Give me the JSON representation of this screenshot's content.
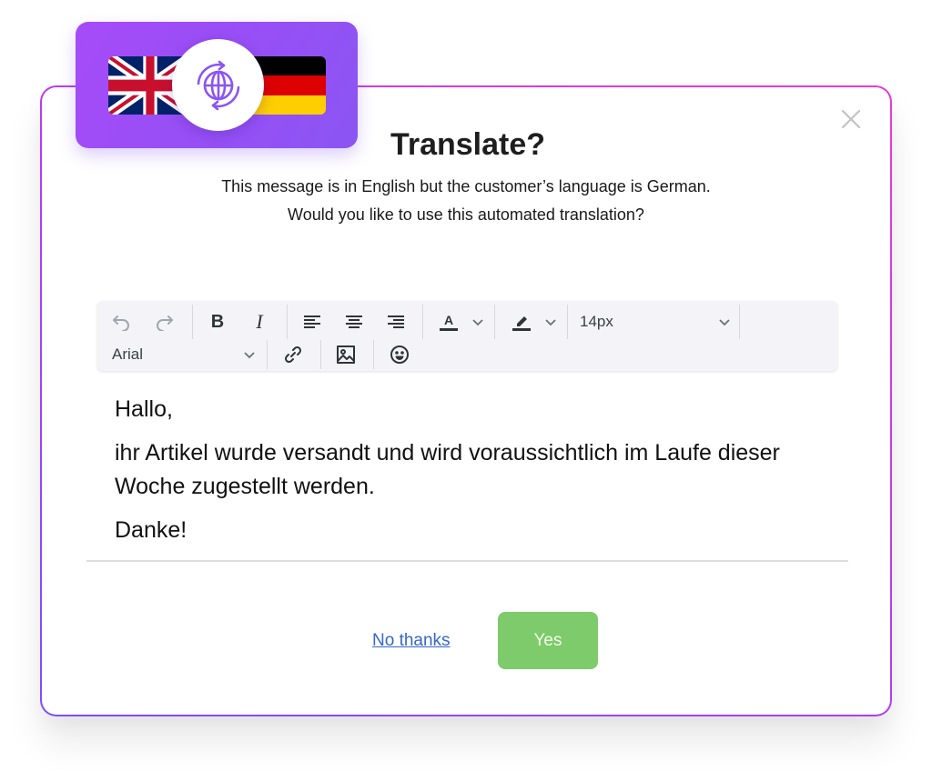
{
  "dialog": {
    "title": "Translate?",
    "message_line1": "This message is in English but the customer’s language is German.",
    "message_line2": "Would you like to use this automated translation?",
    "source_language": "English",
    "target_language": "German",
    "icons": {
      "source_flag": "uk-flag-icon",
      "target_flag": "germany-flag-icon",
      "translate": "globe-sync-icon",
      "close": "close-icon"
    }
  },
  "toolbar": {
    "undo": "undo-icon",
    "redo": "redo-icon",
    "bold": "bold-icon",
    "italic": "italic-icon",
    "align_left": "align-left-icon",
    "align_center": "align-center-icon",
    "align_right": "align-right-icon",
    "text_color": "text-color-icon",
    "highlight": "highlight-icon",
    "font_size": "14px",
    "font_family": "Arial",
    "link": "link-icon",
    "image": "image-icon",
    "emoji": "emoji-icon"
  },
  "editor": {
    "paragraphs": [
      "Hallo,",
      "ihr Artikel wurde versandt und wird voraussichtlich im Laufe dieser Woche zugestellt werden.",
      "Danke!"
    ]
  },
  "actions": {
    "decline_label": "No thanks",
    "accept_label": "Yes"
  },
  "colors": {
    "accent_purple": "#9a4ef6",
    "border_magenta": "#e93bd7",
    "accept_green": "#7dcb6a",
    "link_blue": "#3567c8"
  }
}
